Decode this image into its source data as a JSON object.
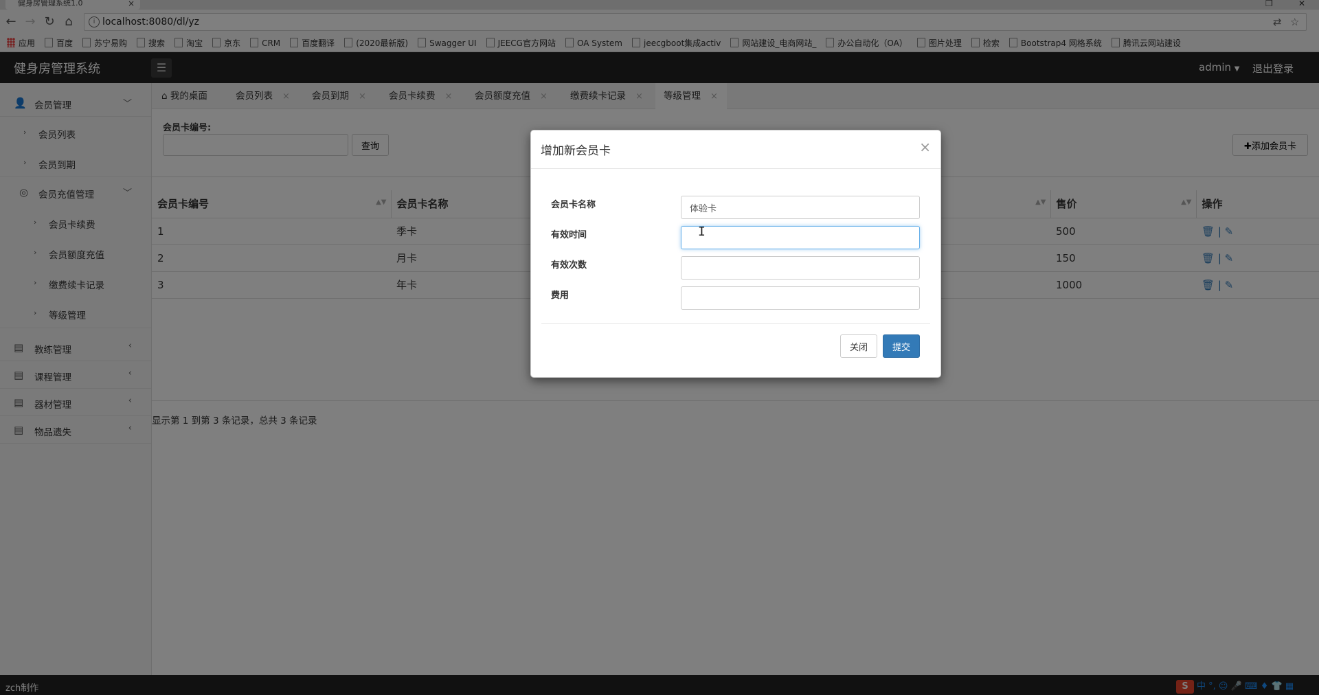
{
  "browser": {
    "tab_title": "健身房管理系统1.0",
    "url": "localhost:8080/dl/yz",
    "bookmarks": [
      "应用",
      "百度",
      "苏宁易购",
      "搜索",
      "淘宝",
      "京东",
      "CRM",
      "百度翻译",
      "(2020最新版)",
      "Swagger UI",
      "JEECG官方网站",
      "OA System",
      "jeecgboot集成activ",
      "网站建设_电商网站_",
      "办公自动化（OA）",
      "图片处理",
      "检索",
      "Bootstrap4 网格系统",
      "腾讯云网站建设"
    ]
  },
  "header": {
    "title": "健身房管理系统",
    "user": "admin",
    "logout": "退出登录"
  },
  "sidebar": {
    "items": [
      {
        "label": "会员管理",
        "level": 0,
        "icon": "user-icon",
        "arrow": "chevron-down-icon"
      },
      {
        "label": "会员列表",
        "level": 1
      },
      {
        "label": "会员到期",
        "level": 1
      },
      {
        "label": "会员充值管理",
        "level": 1,
        "icon": "circle-user-icon",
        "arrow": "chevron-down-icon"
      },
      {
        "label": "会员卡续费",
        "level": 2
      },
      {
        "label": "会员额度充值",
        "level": 2
      },
      {
        "label": "缴费续卡记录",
        "level": 2
      },
      {
        "label": "等级管理",
        "level": 2
      },
      {
        "label": "教练管理",
        "level": 0,
        "icon": "document-icon",
        "arrow": "chevron-left-icon"
      },
      {
        "label": "课程管理",
        "level": 0,
        "icon": "document-icon",
        "arrow": "chevron-left-icon"
      },
      {
        "label": "器材管理",
        "level": 0,
        "icon": "document-icon",
        "arrow": "chevron-left-icon"
      },
      {
        "label": "物品遗失",
        "level": 0,
        "icon": "document-icon",
        "arrow": "chevron-left-icon"
      }
    ]
  },
  "tabs": [
    {
      "label": "我的桌面",
      "closable": false
    },
    {
      "label": "会员列表",
      "closable": true
    },
    {
      "label": "会员到期",
      "closable": true
    },
    {
      "label": "会员卡续费",
      "closable": true
    },
    {
      "label": "会员额度充值",
      "closable": true
    },
    {
      "label": "缴费续卡记录",
      "closable": true
    },
    {
      "label": "等级管理",
      "closable": true,
      "active": true
    }
  ],
  "main": {
    "search_label": "会员卡编号:",
    "search_button": "查询",
    "add_button": "✚添加会员卡",
    "columns": [
      "会员卡编号",
      "会员卡名称",
      "售价",
      "操作"
    ],
    "rows": [
      {
        "id": "1",
        "name": "季卡",
        "price": "500"
      },
      {
        "id": "2",
        "name": "月卡",
        "price": "150"
      },
      {
        "id": "3",
        "name": "年卡",
        "price": "1000"
      }
    ],
    "footer": "显示第 1 到第 3 条记录，总共 3 条记录"
  },
  "modal": {
    "title": "增加新会员卡",
    "fields": [
      {
        "label": "会员卡名称",
        "value": "体验卡"
      },
      {
        "label": "有效时间",
        "value": ""
      },
      {
        "label": "有效次数",
        "value": ""
      },
      {
        "label": "费用",
        "value": ""
      }
    ],
    "close_button": "关闭",
    "submit_button": "提交"
  },
  "bottom": {
    "text": "zch制作"
  },
  "colors": {
    "primary": "#337ab7",
    "header_bg": "#222222"
  }
}
